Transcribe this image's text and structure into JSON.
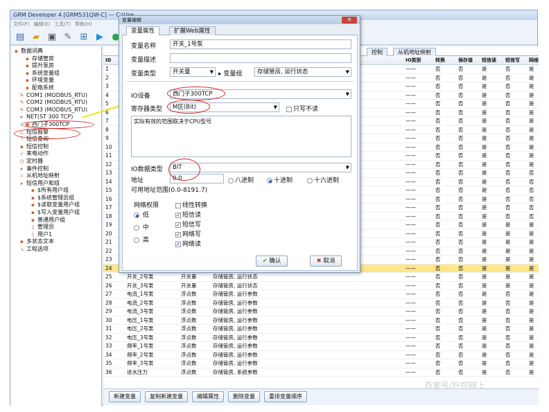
{
  "window": {
    "title": "GRM Developer 4 [GRM531QW-C] — C:\\Use",
    "menu": [
      "文件(F)",
      "编辑(E)",
      "工具(T)",
      "帮助(H)"
    ]
  },
  "tree": [
    {
      "label": "数据词典",
      "indent": 0,
      "icon": "▪"
    },
    {
      "label": "存储管房",
      "indent": 2,
      "icon": "▪"
    },
    {
      "label": "提升泵房",
      "indent": 2,
      "icon": "▪"
    },
    {
      "label": "系统变量组",
      "indent": 2,
      "icon": "▪"
    },
    {
      "label": "环境变量",
      "indent": 2,
      "icon": "▪"
    },
    {
      "label": "配电系统",
      "indent": 2,
      "icon": "▪"
    },
    {
      "label": "COM1 (MODBUS_RTU)",
      "indent": 1,
      "icon": "✎"
    },
    {
      "label": "COM2 (MODBUS_RTU)",
      "indent": 1,
      "icon": "✎"
    },
    {
      "label": "COM3 (MODBUS_RTU)",
      "indent": 1,
      "icon": "✎"
    },
    {
      "label": "NET(ST 300 TCP)",
      "indent": 1,
      "icon": "▸"
    },
    {
      "label": "西门子300TCP",
      "indent": 2,
      "icon": "▣"
    },
    {
      "label": "短信报警",
      "indent": 1,
      "icon": "△"
    },
    {
      "label": "短信查询",
      "indent": 1,
      "icon": "?"
    },
    {
      "label": "短信控制",
      "indent": 1,
      "icon": "▪"
    },
    {
      "label": "来电动作",
      "indent": 1,
      "icon": "✓"
    },
    {
      "label": "定时器",
      "indent": 1,
      "icon": "◷"
    },
    {
      "label": "事件控制",
      "indent": 1,
      "icon": "▸"
    },
    {
      "label": "从机地址映射",
      "indent": 1,
      "icon": "▫"
    },
    {
      "label": "短信用户和组",
      "indent": 1,
      "icon": "▸"
    },
    {
      "label": "$所有用户组",
      "indent": 3,
      "icon": "▪"
    },
    {
      "label": "$系统管理员组",
      "indent": 3,
      "icon": "▪"
    },
    {
      "label": "$读取变量用户组",
      "indent": 3,
      "icon": "▪"
    },
    {
      "label": "$写入变量用户组",
      "indent": 3,
      "icon": "▪"
    },
    {
      "label": "普通用户组",
      "indent": 3,
      "icon": "▪"
    },
    {
      "label": "管理员",
      "indent": 3,
      "icon": "▯"
    },
    {
      "label": "用户1",
      "indent": 3,
      "icon": "▯"
    },
    {
      "label": "多状态文本",
      "indent": 1,
      "icon": "▪"
    },
    {
      "label": "工程选项",
      "indent": 1,
      "icon": "↘"
    }
  ],
  "grid": {
    "tabs": [
      "控制",
      "从机地址映射"
    ],
    "left_header": "ID",
    "right_headers": [
      "IO类型",
      "转换",
      "保存值",
      "短信读",
      "短信写",
      "网络"
    ],
    "rows": [
      {
        "id": "1",
        "name": "",
        "type": "",
        "group": "",
        "io": "——",
        "conv": "否",
        "save": "否",
        "sr": "是",
        "sw": "否",
        "net": "是"
      },
      {
        "id": "2",
        "name": "",
        "type": "",
        "group": "",
        "io": "——",
        "conv": "否",
        "save": "否",
        "sr": "是",
        "sw": "否",
        "net": "是"
      },
      {
        "id": "3",
        "name": "",
        "type": "",
        "group": "",
        "io": "——",
        "conv": "否",
        "save": "否",
        "sr": "是",
        "sw": "否",
        "net": "是"
      },
      {
        "id": "4",
        "name": "",
        "type": "",
        "group": "",
        "io": "——",
        "conv": "否",
        "save": "否",
        "sr": "是",
        "sw": "否",
        "net": "是"
      },
      {
        "id": "5",
        "name": "",
        "type": "",
        "group": "",
        "io": "——",
        "conv": "否",
        "save": "否",
        "sr": "是",
        "sw": "否",
        "net": "是"
      },
      {
        "id": "6",
        "name": "",
        "type": "",
        "group": "",
        "io": "——",
        "conv": "否",
        "save": "否",
        "sr": "是",
        "sw": "否",
        "net": "是"
      },
      {
        "id": "7",
        "name": "",
        "type": "",
        "group": "",
        "io": "——",
        "conv": "否",
        "save": "否",
        "sr": "是",
        "sw": "否",
        "net": "是"
      },
      {
        "id": "8",
        "name": "",
        "type": "",
        "group": "",
        "io": "——",
        "conv": "否",
        "save": "否",
        "sr": "是",
        "sw": "否",
        "net": "是"
      },
      {
        "id": "9",
        "name": "",
        "type": "",
        "group": "",
        "io": "——",
        "conv": "否",
        "save": "否",
        "sr": "是",
        "sw": "否",
        "net": "是"
      },
      {
        "id": "10",
        "name": "",
        "type": "",
        "group": "",
        "io": "——",
        "conv": "否",
        "save": "否",
        "sr": "是",
        "sw": "否",
        "net": "是"
      },
      {
        "id": "11",
        "name": "",
        "type": "",
        "group": "",
        "io": "——",
        "conv": "否",
        "save": "否",
        "sr": "是",
        "sw": "否",
        "net": "是"
      },
      {
        "id": "12",
        "name": "",
        "type": "",
        "group": "",
        "io": "——",
        "conv": "否",
        "save": "否",
        "sr": "是",
        "sw": "否",
        "net": "是"
      },
      {
        "id": "13",
        "name": "",
        "type": "",
        "group": "",
        "io": "——",
        "conv": "否",
        "save": "否",
        "sr": "是",
        "sw": "否",
        "net": "否"
      },
      {
        "id": "14",
        "name": "",
        "type": "",
        "group": "",
        "io": "——",
        "conv": "否",
        "save": "否",
        "sr": "是",
        "sw": "否",
        "net": "否"
      },
      {
        "id": "15",
        "name": "",
        "type": "",
        "group": "",
        "io": "——",
        "conv": "否",
        "save": "否",
        "sr": "是",
        "sw": "否",
        "net": "否"
      },
      {
        "id": "16",
        "name": "",
        "type": "",
        "group": "",
        "io": "——",
        "conv": "否",
        "save": "否",
        "sr": "是",
        "sw": "否",
        "net": "否"
      },
      {
        "id": "17",
        "name": "",
        "type": "",
        "group": "",
        "io": "——",
        "conv": "否",
        "save": "否",
        "sr": "是",
        "sw": "否",
        "net": "否"
      },
      {
        "id": "18",
        "name": "",
        "type": "",
        "group": "",
        "io": "——",
        "conv": "否",
        "save": "否",
        "sr": "是",
        "sw": "否",
        "net": "否"
      },
      {
        "id": "19",
        "name": "",
        "type": "",
        "group": "",
        "io": "——",
        "conv": "否",
        "save": "否",
        "sr": "是",
        "sw": "是",
        "net": "是"
      },
      {
        "id": "20",
        "name": "",
        "type": "",
        "group": "",
        "io": "——",
        "conv": "否",
        "save": "否",
        "sr": "是",
        "sw": "是",
        "net": "是"
      },
      {
        "id": "21",
        "name": "",
        "type": "",
        "group": "",
        "io": "——",
        "conv": "否",
        "save": "否",
        "sr": "是",
        "sw": "是",
        "net": "是"
      },
      {
        "id": "22",
        "name": "",
        "type": "",
        "group": "",
        "io": "——",
        "conv": "否",
        "save": "否",
        "sr": "是",
        "sw": "是",
        "net": "是"
      },
      {
        "id": "23",
        "name": "",
        "type": "",
        "group": "",
        "io": "——",
        "conv": "否",
        "save": "否",
        "sr": "是",
        "sw": "是",
        "net": "是"
      },
      {
        "id": "24",
        "name": "开关_1号泵",
        "type": "开关量",
        "group": "存储管房, 运行状态",
        "io": "——",
        "conv": "否",
        "save": "否",
        "sr": "是",
        "sw": "是",
        "net": "是",
        "selected": true
      },
      {
        "id": "25",
        "name": "开关_2号泵",
        "type": "开关量",
        "group": "存储管房, 运行状态",
        "io": "——",
        "conv": "否",
        "save": "否",
        "sr": "是",
        "sw": "是",
        "net": "是"
      },
      {
        "id": "26",
        "name": "开关_3号泵",
        "type": "开关量",
        "group": "存储管房, 运行状态",
        "io": "——",
        "conv": "否",
        "save": "否",
        "sr": "是",
        "sw": "是",
        "net": "是"
      },
      {
        "id": "27",
        "name": "电流_1号泵",
        "type": "浮点数",
        "group": "存储管房, 运行参数",
        "io": "——",
        "conv": "否",
        "save": "否",
        "sr": "是",
        "sw": "否",
        "net": "是"
      },
      {
        "id": "28",
        "name": "电流_2号泵",
        "type": "浮点数",
        "group": "存储管房, 运行参数",
        "io": "——",
        "conv": "否",
        "save": "否",
        "sr": "是",
        "sw": "否",
        "net": "是"
      },
      {
        "id": "29",
        "name": "电流_3号泵",
        "type": "浮点数",
        "group": "存储管房, 运行参数",
        "io": "——",
        "conv": "否",
        "save": "否",
        "sr": "是",
        "sw": "否",
        "net": "是"
      },
      {
        "id": "30",
        "name": "电压_1号泵",
        "type": "浮点数",
        "group": "存储管房, 运行参数",
        "io": "——",
        "conv": "否",
        "save": "否",
        "sr": "是",
        "sw": "否",
        "net": "是"
      },
      {
        "id": "31",
        "name": "电压_2号泵",
        "type": "浮点数",
        "group": "存储管房, 运行参数",
        "io": "——",
        "conv": "否",
        "save": "否",
        "sr": "是",
        "sw": "否",
        "net": "是"
      },
      {
        "id": "32",
        "name": "电压_3号泵",
        "type": "浮点数",
        "group": "存储管房, 运行参数",
        "io": "——",
        "conv": "否",
        "save": "否",
        "sr": "是",
        "sw": "否",
        "net": "是"
      },
      {
        "id": "33",
        "name": "频率_1号泵",
        "type": "浮点数",
        "group": "存储管房, 运行参数",
        "io": "——",
        "conv": "否",
        "save": "否",
        "sr": "是",
        "sw": "否",
        "net": "是"
      },
      {
        "id": "34",
        "name": "频率_2号泵",
        "type": "浮点数",
        "group": "存储管房, 运行参数",
        "io": "——",
        "conv": "否",
        "save": "否",
        "sr": "是",
        "sw": "否",
        "net": "是"
      },
      {
        "id": "35",
        "name": "频率_3号泵",
        "type": "浮点数",
        "group": "存储管房, 运行参数",
        "io": "——",
        "conv": "否",
        "save": "否",
        "sr": "是",
        "sw": "否",
        "net": "是"
      },
      {
        "id": "36",
        "name": "进水压力",
        "type": "浮点数",
        "group": "存储管房, 系统参数",
        "io": "——",
        "conv": "否",
        "save": "否",
        "sr": "是",
        "sw": "否",
        "net": "是"
      }
    ]
  },
  "bottom_buttons": [
    "新建变量",
    "复制新建变量",
    "编辑属性",
    "删除变量",
    "重排变量顺序"
  ],
  "dialog": {
    "title": "变量编辑",
    "tabs": [
      "变量属性",
      "扩展Web属性"
    ],
    "name_label": "变量名称",
    "name_value": "开关_1号泵",
    "desc_label": "变量描述",
    "desc_value": "",
    "type_label": "变量类型",
    "type_value": "开关量",
    "group_label": "变量组",
    "group_value": "存储管房, 运行状态",
    "io_label": "IO设备",
    "io_value": "西门子300TCP",
    "reg_label": "寄存器类型",
    "reg_value": "M区(Bit)",
    "readonly_label": "只写不读",
    "note": "实际有效的范围取决于CPU型号",
    "dtype_label": "IO数据类型",
    "dtype_value": "BIT",
    "addr_label": "地址",
    "addr_value": "0.0",
    "radix_oct": "八进制",
    "radix_dec": "十进制",
    "radix_hex": "十六进制",
    "range_text": "可用地址范围(0.0-8191.7)",
    "perm_label": "网络权限",
    "perm_low": "低",
    "perm_mid": "中",
    "perm_high": "高",
    "linear_label": "线性转换",
    "sms_read": "短信读",
    "sms_write": "短信写",
    "net_write": "网络写",
    "net_read": "网络读",
    "ok": "确认",
    "cancel": "取消"
  },
  "watermark": "百家号/巨控网上",
  "colors": {
    "accent": "#d0201a",
    "arrow": "#e8e81a",
    "selected_row": "#fde68a"
  }
}
